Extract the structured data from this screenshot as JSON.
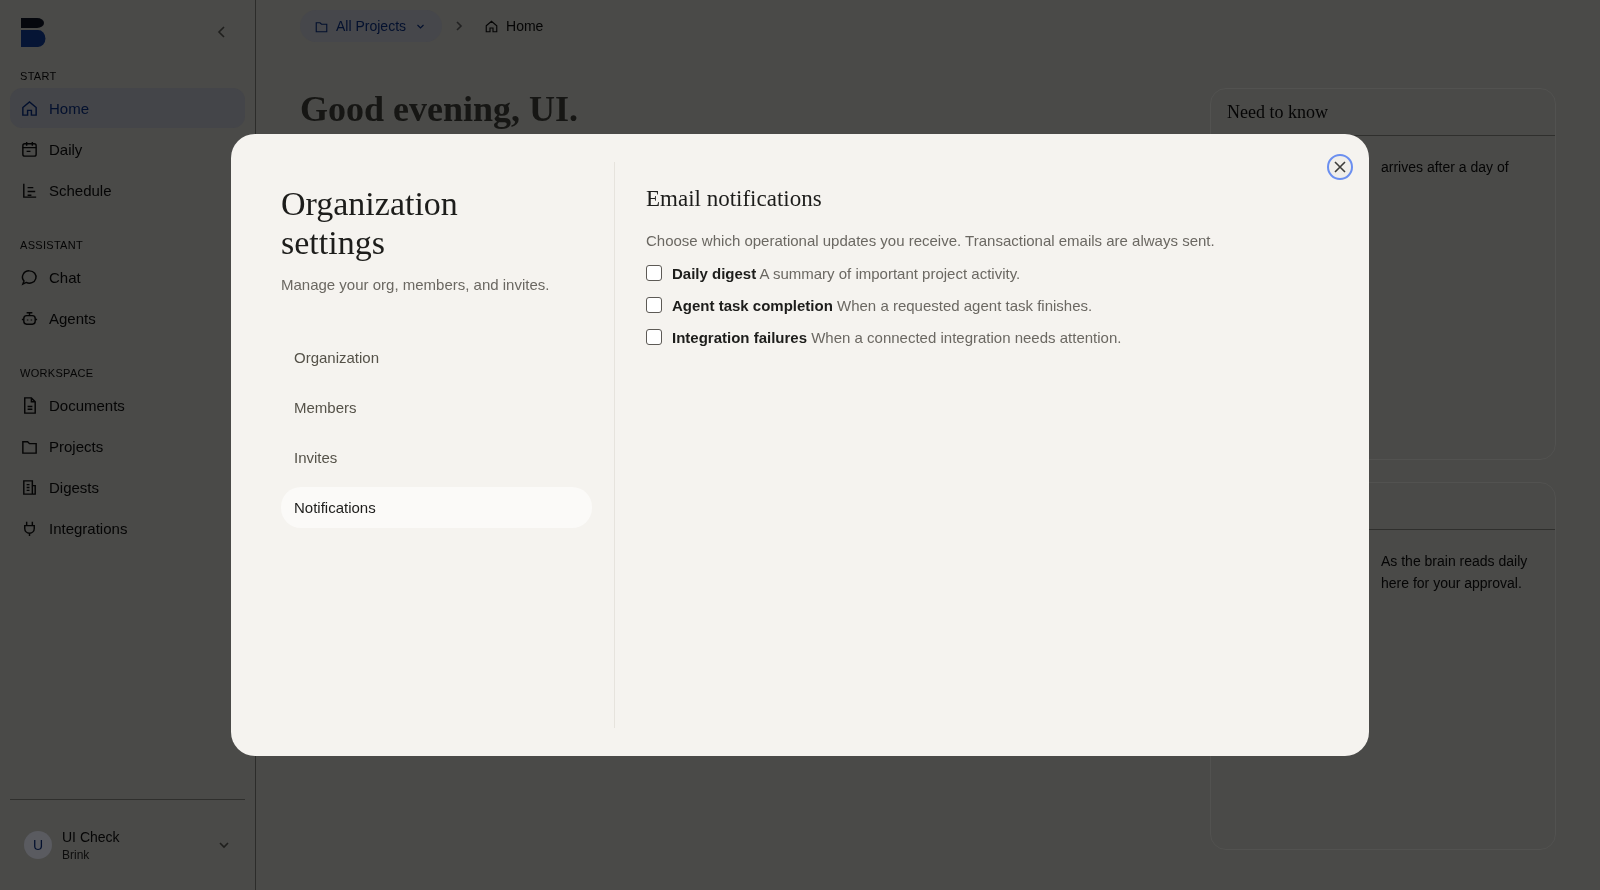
{
  "sidebar": {
    "sections": [
      {
        "heading": "START",
        "items": [
          {
            "label": "Home",
            "selected": true
          },
          {
            "label": "Daily",
            "selected": false
          },
          {
            "label": "Schedule",
            "selected": false
          }
        ]
      },
      {
        "heading": "ASSISTANT",
        "items": [
          {
            "label": "Chat",
            "selected": false
          },
          {
            "label": "Agents",
            "selected": false
          }
        ]
      },
      {
        "heading": "WORKSPACE",
        "items": [
          {
            "label": "Documents",
            "selected": false
          },
          {
            "label": "Projects",
            "selected": false
          },
          {
            "label": "Digests",
            "selected": false
          },
          {
            "label": "Integrations",
            "selected": false
          }
        ]
      }
    ],
    "user": {
      "initial": "U",
      "name": "UI Check",
      "org": "Brink"
    }
  },
  "breadcrumb": {
    "project": "All Projects",
    "page": "Home"
  },
  "greeting": "Good evening, UI.",
  "cards": [
    {
      "title": "Need to know",
      "lines": [
        "arrives after a day of"
      ]
    },
    {
      "lines": [
        "As the brain reads daily",
        "here for your approval."
      ]
    }
  ],
  "modal": {
    "title": "Organization settings",
    "subtitle": "Manage your org, members, and invites.",
    "nav": [
      {
        "label": "Organization",
        "selected": false
      },
      {
        "label": "Members",
        "selected": false
      },
      {
        "label": "Invites",
        "selected": false
      },
      {
        "label": "Notifications",
        "selected": true
      }
    ],
    "section_title": "Email notifications",
    "description": "Choose which operational updates you receive. Transactional emails are always sent.",
    "options": [
      {
        "label": "Daily digest",
        "detail": "A summary of important project activity.",
        "checked": false
      },
      {
        "label": "Agent task completion",
        "detail": "When a requested agent task finishes.",
        "checked": false
      },
      {
        "label": "Integration failures",
        "detail": "When a connected integration needs attention.",
        "checked": false
      }
    ]
  }
}
